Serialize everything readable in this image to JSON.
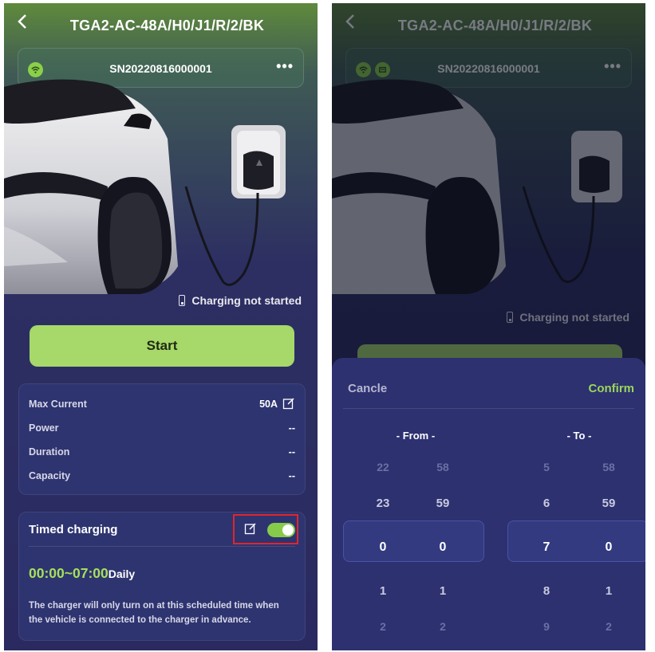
{
  "app": {
    "title": "TGA2-AC-48A/H0/J1/R/2/BK",
    "serial": "SN20220816000001",
    "more_glyph": "•••",
    "back_glyph": "<"
  },
  "status": {
    "text": "Charging not started"
  },
  "start_button": {
    "label": "Start"
  },
  "info": {
    "rows": [
      {
        "label": "Max Current",
        "value": "50A"
      },
      {
        "label": "Power",
        "value": "--"
      },
      {
        "label": "Duration",
        "value": "--"
      },
      {
        "label": "Capacity",
        "value": "--"
      }
    ]
  },
  "timed_charging": {
    "title": "Timed charging",
    "enabled": true,
    "range": "00:00~07:00",
    "repeat": "Daily",
    "description": "The charger will only turn on at this scheduled time when the vehicle is connected to the charger in advance."
  },
  "picker": {
    "cancel_label": "Cancle",
    "confirm_label": "Confirm",
    "from_label": "- From -",
    "to_label": "- To -",
    "from_hours": [
      "22",
      "23",
      "0",
      "1",
      "2"
    ],
    "from_minutes": [
      "58",
      "59",
      "0",
      "1",
      "2"
    ],
    "to_hours": [
      "5",
      "6",
      "7",
      "8",
      "9"
    ],
    "to_minutes": [
      "58",
      "59",
      "0",
      "1",
      "2"
    ]
  },
  "colors": {
    "accent": "#a6d86a",
    "time_text": "#a6e05a",
    "highlight_box": "#e0262b",
    "card_bg": "#2e3470"
  }
}
